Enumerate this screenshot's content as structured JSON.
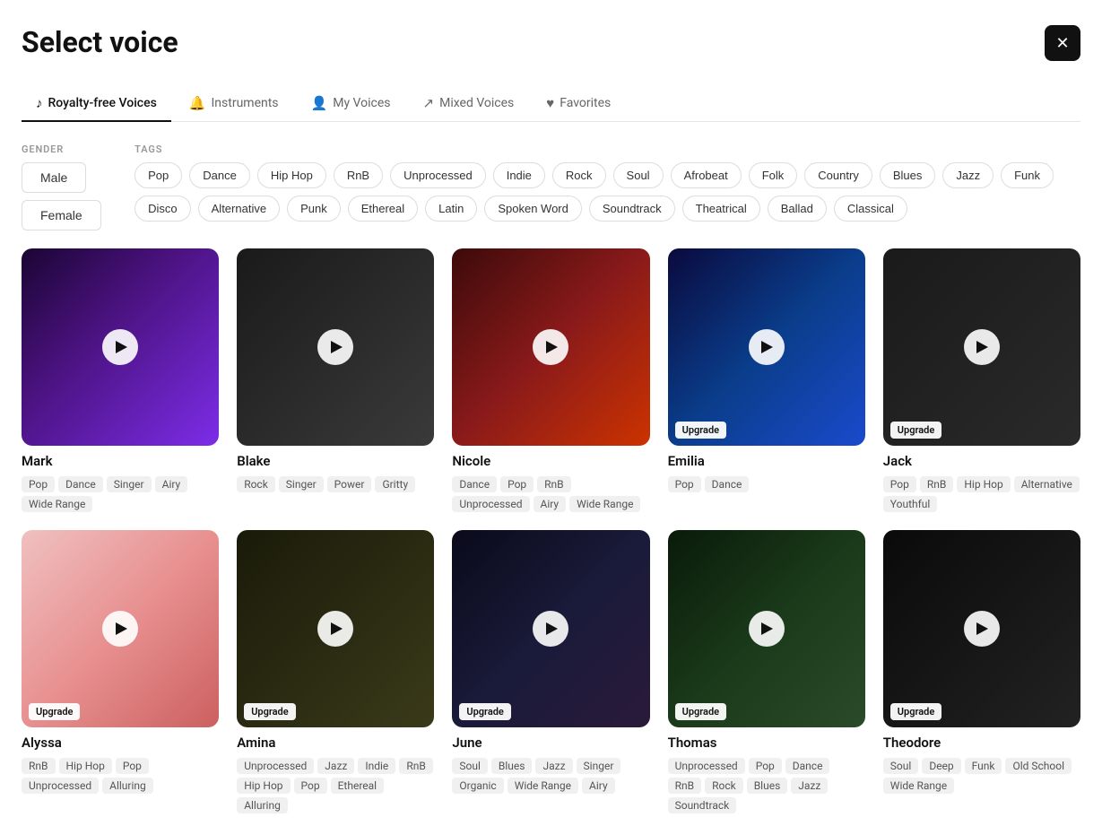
{
  "page": {
    "title": "Select voice",
    "close_label": "×"
  },
  "tabs": [
    {
      "id": "royalty-free",
      "label": "Royalty-free Voices",
      "icon": "♪",
      "active": true
    },
    {
      "id": "instruments",
      "label": "Instruments",
      "icon": "🔔",
      "active": false
    },
    {
      "id": "my-voices",
      "label": "My Voices",
      "icon": "👤",
      "active": false
    },
    {
      "id": "mixed-voices",
      "label": "Mixed Voices",
      "icon": "↗",
      "active": false
    },
    {
      "id": "favorites",
      "label": "Favorites",
      "icon": "♥",
      "active": false
    }
  ],
  "filters": {
    "gender": {
      "label": "GENDER",
      "options": [
        "Male",
        "Female"
      ]
    },
    "tags": {
      "label": "TAGS",
      "options": [
        "Pop",
        "Dance",
        "Hip Hop",
        "RnB",
        "Unprocessed",
        "Indie",
        "Rock",
        "Soul",
        "Afrobeat",
        "Folk",
        "Country",
        "Blues",
        "Jazz",
        "Funk",
        "Disco",
        "Alternative",
        "Punk",
        "Ethereal",
        "Latin",
        "Spoken Word",
        "Soundtrack",
        "Theatrical",
        "Ballad",
        "Classical"
      ]
    }
  },
  "voices": [
    {
      "id": "mark",
      "name": "Mark",
      "bg_class": "bg-mark",
      "upgrade": false,
      "tags": [
        "Pop",
        "Dance",
        "Singer",
        "Airy",
        "Wide Range"
      ]
    },
    {
      "id": "blake",
      "name": "Blake",
      "bg_class": "bg-blake",
      "upgrade": false,
      "tags": [
        "Rock",
        "Singer",
        "Power",
        "Gritty"
      ]
    },
    {
      "id": "nicole",
      "name": "Nicole",
      "bg_class": "bg-nicole",
      "upgrade": false,
      "tags": [
        "Dance",
        "Pop",
        "RnB",
        "Unprocessed",
        "Airy",
        "Wide Range"
      ]
    },
    {
      "id": "emilia",
      "name": "Emilia",
      "bg_class": "bg-emilia",
      "upgrade": true,
      "upgrade_label": "Upgrade",
      "tags": [
        "Pop",
        "Dance"
      ]
    },
    {
      "id": "jack",
      "name": "Jack",
      "bg_class": "bg-jack",
      "upgrade": true,
      "upgrade_label": "Upgrade",
      "tags": [
        "Pop",
        "RnB",
        "Hip Hop",
        "Alternative",
        "Youthful"
      ]
    },
    {
      "id": "alyssa",
      "name": "Alyssa",
      "bg_class": "bg-alyssa",
      "upgrade": true,
      "upgrade_label": "Upgrade",
      "tags": [
        "RnB",
        "Hip Hop",
        "Pop",
        "Unprocessed",
        "Alluring"
      ]
    },
    {
      "id": "amina",
      "name": "Amina",
      "bg_class": "bg-amina",
      "upgrade": true,
      "upgrade_label": "Upgrade",
      "tags": [
        "Unprocessed",
        "Jazz",
        "Indie",
        "RnB",
        "Hip Hop",
        "Pop",
        "Ethereal",
        "Alluring"
      ]
    },
    {
      "id": "june",
      "name": "June",
      "bg_class": "bg-june",
      "upgrade": true,
      "upgrade_label": "Upgrade",
      "tags": [
        "Soul",
        "Blues",
        "Jazz",
        "Singer",
        "Organic",
        "Wide Range",
        "Airy"
      ]
    },
    {
      "id": "thomas",
      "name": "Thomas",
      "bg_class": "bg-thomas",
      "upgrade": true,
      "upgrade_label": "Upgrade",
      "tags": [
        "Unprocessed",
        "Pop",
        "Dance",
        "RnB",
        "Rock",
        "Blues",
        "Jazz",
        "Soundtrack"
      ]
    },
    {
      "id": "theodore",
      "name": "Theodore",
      "bg_class": "bg-theodore",
      "upgrade": true,
      "upgrade_label": "Upgrade",
      "tags": [
        "Soul",
        "Deep",
        "Funk",
        "Old School",
        "Wide Range"
      ]
    }
  ]
}
